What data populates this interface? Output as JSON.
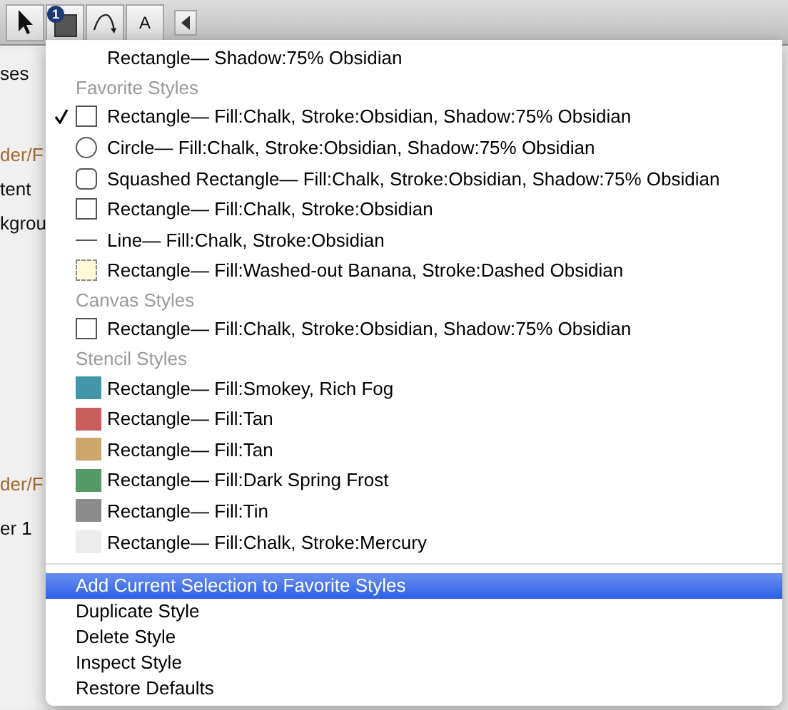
{
  "toolbar": {
    "badge": "1",
    "text_tool": "A"
  },
  "sidebar": [
    {
      "text": "ses",
      "kind": "label"
    },
    {
      "text": "der/F",
      "kind": "accent"
    },
    {
      "text": "tent",
      "kind": "label"
    },
    {
      "text": "kgrou",
      "kind": "label"
    },
    {
      "text": "der/F",
      "kind": "accent"
    },
    {
      "text": "er 1",
      "kind": "label"
    }
  ],
  "menu": {
    "top_item": "Rectangle— Shadow:75% Obsidian",
    "groups": [
      {
        "heading": "Favorite Styles",
        "items": [
          {
            "label": "Rectangle— Fill:Chalk, Stroke:Obsidian, Shadow:75% Obsidian",
            "kind": "rect",
            "checked": true
          },
          {
            "label": "Circle— Fill:Chalk, Stroke:Obsidian, Shadow:75% Obsidian",
            "kind": "circle",
            "checked": false
          },
          {
            "label": "Squashed Rectangle— Fill:Chalk, Stroke:Obsidian, Shadow:75% Obsidian",
            "kind": "rounded",
            "checked": false
          },
          {
            "label": "Rectangle— Fill:Chalk, Stroke:Obsidian",
            "kind": "rect",
            "checked": false
          },
          {
            "label": "Line— Fill:Chalk, Stroke:Obsidian",
            "kind": "line",
            "checked": false
          },
          {
            "label": "Rectangle— Fill:Washed-out Banana, Stroke:Dashed Obsidian",
            "kind": "dashed",
            "checked": false
          }
        ]
      },
      {
        "heading": "Canvas Styles",
        "items": [
          {
            "label": "Rectangle— Fill:Chalk, Stroke:Obsidian, Shadow:75% Obsidian",
            "kind": "rect",
            "checked": false
          }
        ]
      },
      {
        "heading": "Stencil Styles",
        "items": [
          {
            "label": "Rectangle— Fill:Smokey, Rich Fog",
            "kind": "fill",
            "color": "#4396a8",
            "checked": false
          },
          {
            "label": "Rectangle— Fill:Tan",
            "kind": "fill",
            "color": "#c95f5c",
            "checked": false
          },
          {
            "label": "Rectangle— Fill:Tan",
            "kind": "fill",
            "color": "#cda66c",
            "checked": false
          },
          {
            "label": "Rectangle— Fill:Dark Spring Frost",
            "kind": "fill",
            "color": "#559966",
            "checked": false
          },
          {
            "label": "Rectangle— Fill:Tin",
            "kind": "fill",
            "color": "#8c8c8c",
            "checked": false
          },
          {
            "label": "Rectangle— Fill:Chalk, Stroke:Mercury",
            "kind": "fill",
            "color": "#ececec",
            "checked": false
          }
        ]
      }
    ],
    "actions": [
      {
        "label": "Add Current Selection to Favorite Styles",
        "selected": true
      },
      {
        "label": "Duplicate Style",
        "selected": false
      },
      {
        "label": "Delete Style",
        "selected": false
      },
      {
        "label": "Inspect Style",
        "selected": false
      },
      {
        "label": "Restore Defaults",
        "selected": false
      }
    ]
  }
}
